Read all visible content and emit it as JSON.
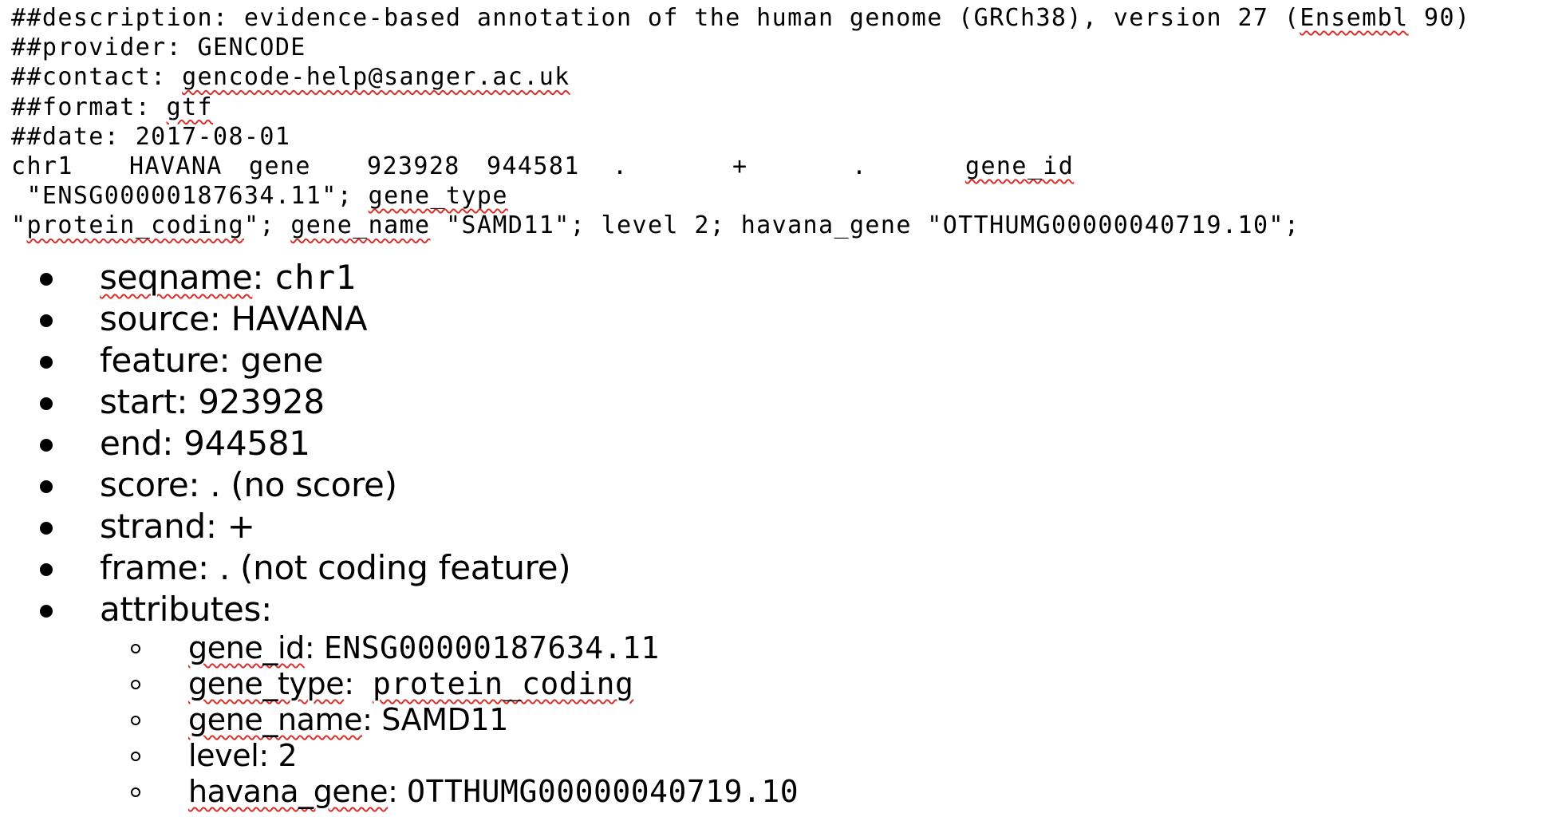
{
  "header_lines": [
    {
      "prefix": "##description: evidence-based annotation of the human genome (GRCh38), version 27 (",
      "marked": "Ensembl",
      "suffix": " 90)"
    },
    {
      "prefix": "##provider: GENCODE",
      "marked": "",
      "suffix": ""
    },
    {
      "prefix": "##contact: ",
      "marked": "gencode-help@sanger.ac.uk",
      "suffix": ""
    },
    {
      "prefix": "##format: ",
      "marked": "gtf",
      "suffix": ""
    },
    {
      "prefix": "##date: 2017-08-01",
      "marked": "",
      "suffix": ""
    }
  ],
  "gtf_record": {
    "seqname": "chr1",
    "source": "HAVANA",
    "feature": "gene",
    "start": "923928",
    "end": "944581",
    "score": ".",
    "strand": "+",
    "frame": ".",
    "attr_gene_id_key": "gene_id",
    "attr_gene_id_val": " \"ENSG00000187634.11\"; ",
    "attr_gene_type_key": "gene_type",
    "attr_gene_type_q1": "\"",
    "attr_gene_type_val": "protein_coding",
    "attr_gene_type_q2": "\"; ",
    "attr_gene_name_key": "gene_name",
    "attr_rest": " \"SAMD11\"; level 2; havana_gene \"OTTHUMG00000040719.10\";"
  },
  "fields": [
    {
      "key": "seqname",
      "sep": ": ",
      "value": "chr1",
      "mono": true,
      "key_marked": true
    },
    {
      "key": "source",
      "sep": ": ",
      "value": "HAVANA",
      "mono": false,
      "key_marked": false
    },
    {
      "key": "feature",
      "sep": ": ",
      "value": "gene",
      "mono": false,
      "key_marked": false
    },
    {
      "key": "start",
      "sep": ": ",
      "value": "923928",
      "mono": false,
      "key_marked": false
    },
    {
      "key": "end",
      "sep": ": ",
      "value": "944581",
      "mono": false,
      "key_marked": false
    },
    {
      "key": "score",
      "sep": ": ",
      "value": ". (no score)",
      "mono": false,
      "key_marked": false
    },
    {
      "key": "strand",
      "sep": ": ",
      "value": "+",
      "mono": false,
      "key_marked": false
    },
    {
      "key": "frame",
      "sep": ": ",
      "value": ". (not coding feature)",
      "mono": false,
      "key_marked": false
    },
    {
      "key": "attributes",
      "sep": ":",
      "value": "",
      "mono": false,
      "key_marked": false
    }
  ],
  "attributes": [
    {
      "key": "gene_id",
      "sep": ": ",
      "value": "ENSG00000187634.11",
      "mono": true,
      "key_marked": true,
      "value_marked": false
    },
    {
      "key": "gene_type",
      "sep": ":  ",
      "value": "protein_coding",
      "mono": true,
      "key_marked": true,
      "value_marked": true
    },
    {
      "key": "gene_name",
      "sep": ": ",
      "value": "SAMD11",
      "mono": false,
      "key_marked": true,
      "value_marked": false
    },
    {
      "key": "level",
      "sep": ": ",
      "value": "2",
      "mono": false,
      "key_marked": false,
      "value_marked": false
    },
    {
      "key": "havana_gene",
      "sep": ": ",
      "value": "OTTHUMG00000040719.10",
      "mono": true,
      "key_marked": true,
      "value_marked": false
    }
  ],
  "spellcheck_color": "#d9302c"
}
